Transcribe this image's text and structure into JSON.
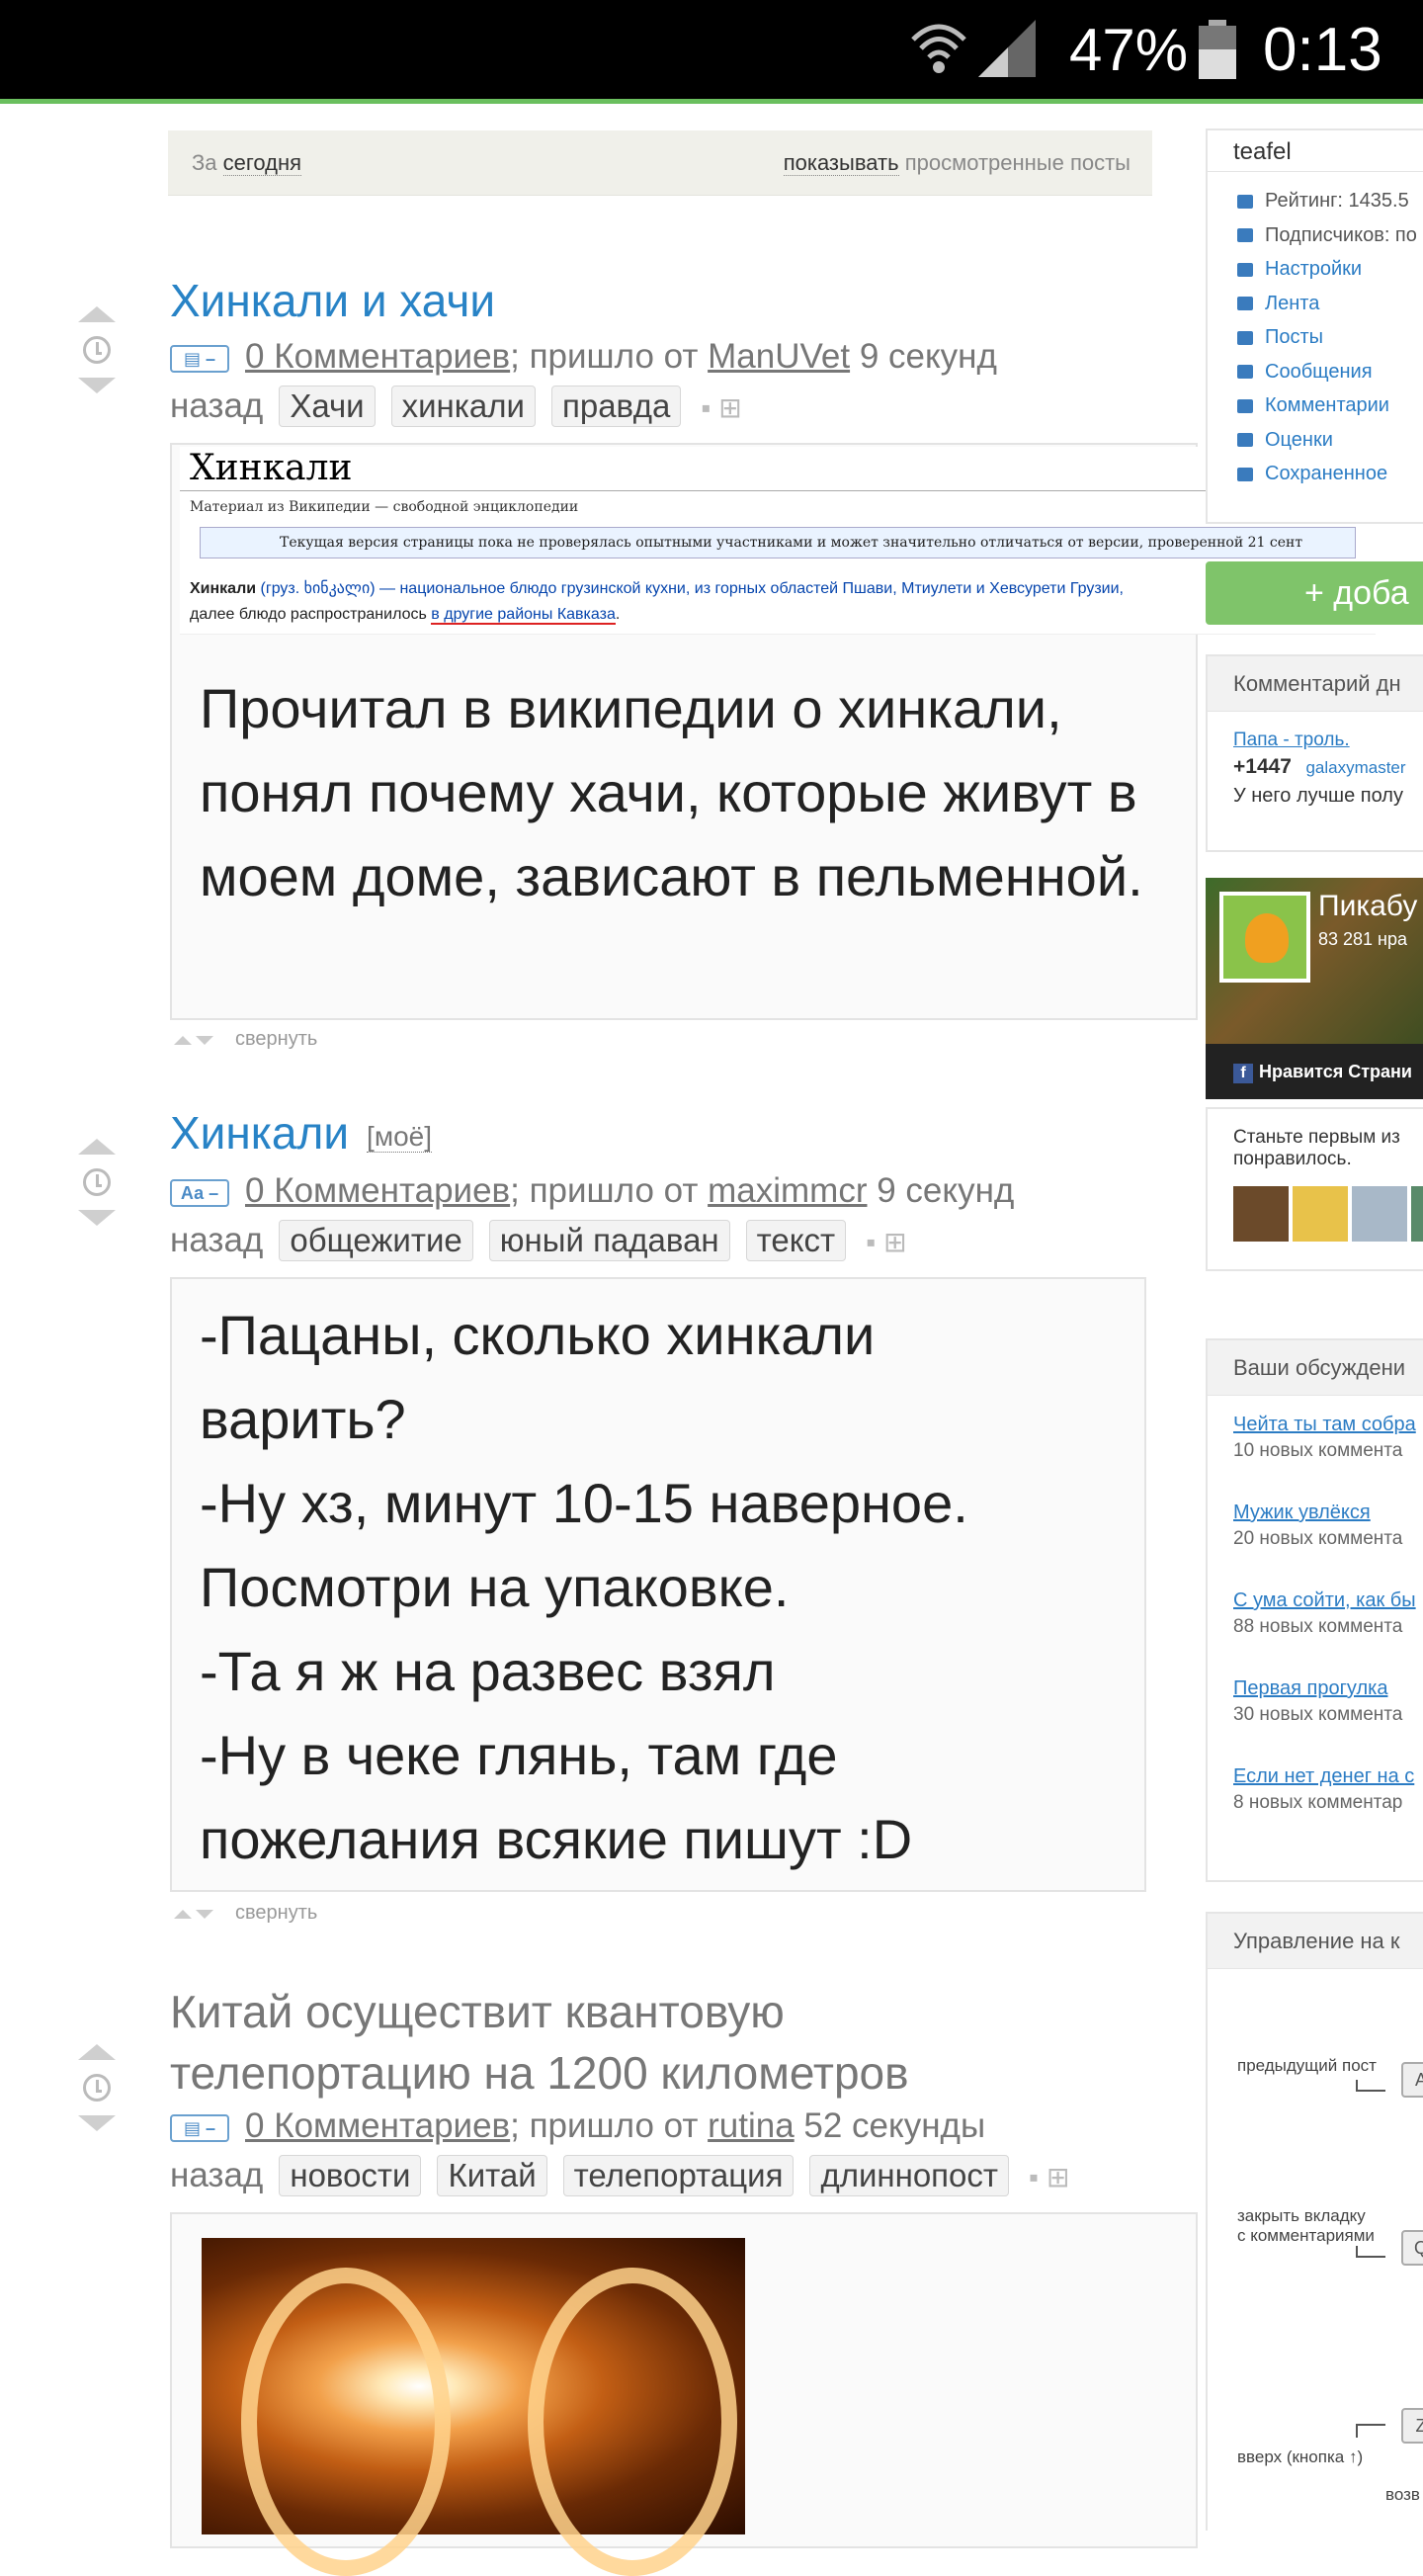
{
  "status": {
    "battery": "47%",
    "time": "0:13"
  },
  "filter": {
    "prefix": "За",
    "period": "сегодня",
    "show": "показывать",
    "show_rest": "просмотренные посты"
  },
  "posts": [
    {
      "title": "Хинкали и хачи",
      "comments": "0 Комментариев",
      "came_from": "; пришло от",
      "author": "ManUVet",
      "time": "9 секунд",
      "time2": "назад",
      "tags": [
        "Хачи",
        "хинкали",
        "правда"
      ],
      "wiki": {
        "title": "Хинкали",
        "source": "Материал из Википедии — свободной энциклопедии",
        "notice": "Текущая версия страницы пока не проверялась опытными участниками и может значительно отличаться от версии, проверенной 21 сент",
        "def_bold": "Хинкали",
        "def_rest": "(груз. ხინკალი) — национальное блюдо грузинской кухни, из горных областей Пшави, Мтиулети и Хевсурети Грузии,",
        "def_line2a": "далее блюдо распространилось ",
        "def_line2b": "в другие районы Кавказа",
        "def_line2c": "."
      },
      "text": "Прочитал в википедии о хинкали, понял почему хачи, которые живут в моем доме, зависают в пельменной.",
      "collapse": "свернуть"
    },
    {
      "title": "Хинкали",
      "mine": "[моё]",
      "type_icon": "Аа –",
      "comments": "0 Комментариев",
      "came_from": "; пришло от",
      "author": "maximmcr",
      "time": "9 секунд",
      "time2": "назад",
      "tags": [
        "общежитие",
        "юный падаван",
        "текст"
      ],
      "lines": [
        "-Пацаны, сколько хинкали",
        "варить?",
        "-Ну хз, минут 10-15 наверное.",
        "Посмотри на упаковке.",
        "-Та я ж на развес взял",
        "-Ну в чеке глянь, там где",
        "пожелания всякие пишут :D"
      ],
      "collapse": "свернуть"
    },
    {
      "title_line1": "Китай осуществит квантовую",
      "title_line2": "телепортацию на 1200 километров",
      "comments": "0 Комментариев",
      "came_from": "; пришло от",
      "author": "rutina",
      "time": "52 секунды",
      "time2": "назад",
      "tags": [
        "новости",
        "Китай",
        "телепортация",
        "длиннопост"
      ]
    }
  ],
  "sidebar": {
    "user": "teafel",
    "menu": [
      "Рейтинг: 1435.5",
      "Подписчиков: по",
      "Настройки",
      "Лента",
      "Посты",
      "Сообщения",
      "Комментарии",
      "Оценки",
      "Сохраненное"
    ],
    "add_label": "+ доба",
    "comment_day": {
      "header": "Комментарий дн",
      "link": "Папа - троль.",
      "score": "+1447",
      "user": "galaxymaster",
      "text": "У него лучше полу"
    },
    "fb": {
      "name": "Пикабу",
      "likes": "83 281 нра",
      "like_btn": "Нравится Страни",
      "first": "Станьте первым из",
      "first2": "понравилось."
    },
    "discussions": {
      "header": "Ваши обсуждени",
      "items": [
        {
          "link": "Чейта ты там собра",
          "count": "10 новых коммента"
        },
        {
          "link": "Мужик увлёкся",
          "count": "20 новых коммента"
        },
        {
          "link": "С ума сойти, как бы",
          "count": "88 новых коммента"
        },
        {
          "link": "Первая прогулка",
          "count": "30 новых коммента"
        },
        {
          "link": "Если нет денег на с",
          "count": "8 новых комментар"
        }
      ]
    },
    "controls": {
      "header": "Управление на к",
      "prev": "предыдущий пост",
      "close1": "закрыть вкладку",
      "close2": "с комментариями",
      "up": "вверх (кнопка ↑)",
      "back": "возв",
      "key_a": "A",
      "key_q": "Q",
      "key_z": "Z"
    }
  }
}
